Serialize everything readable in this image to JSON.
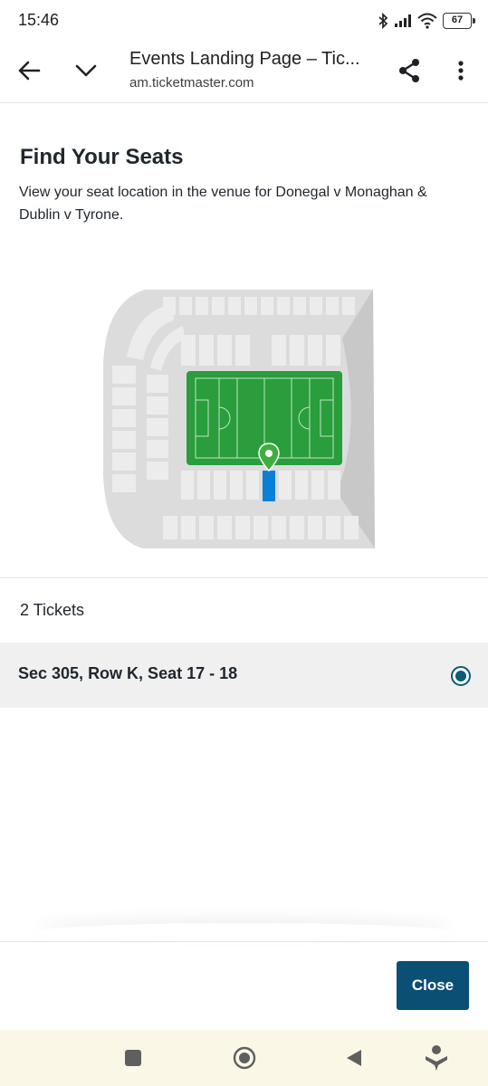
{
  "status_bar": {
    "time": "15:46",
    "battery": "67",
    "icons": [
      "bluetooth-icon",
      "signal-icon",
      "wifi-icon",
      "battery-icon"
    ]
  },
  "browser": {
    "title": "Events Landing Page – Tic...",
    "url": "am.ticketmaster.com",
    "icons": [
      "back-arrow-icon",
      "chevron-down-icon",
      "share-icon",
      "more-vert-icon"
    ]
  },
  "page": {
    "heading": "Find Your Seats",
    "description": "View your seat location in the venue for Donegal v Monaghan & Dublin v Tyrone.",
    "ticket_count": "2 Tickets",
    "ticket_label": "Sec 305, Row K, Seat 17 - 18",
    "ticket_selected": true,
    "close_label": "Close"
  },
  "colors": {
    "pitch": "#2a9d3c",
    "seat_highlight": "#0a7fd8",
    "marker": "#3fae3f",
    "button": "#0b4f74",
    "radio": "#0b5a7a",
    "nav_bar_bg": "#fbf7e7"
  },
  "nav": {
    "icons": [
      "recents-square-icon",
      "home-circle-icon",
      "back-triangle-icon",
      "assistant-icon"
    ]
  }
}
